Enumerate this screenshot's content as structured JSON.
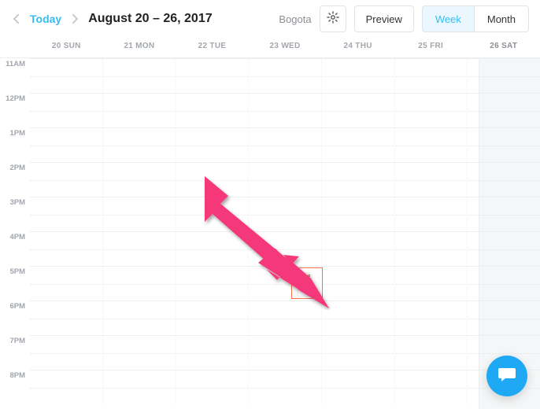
{
  "toolbar": {
    "today_label": "Today",
    "date_range": "August 20 – 26, 2017",
    "timezone": "Bogota",
    "preview_label": "Preview",
    "view_week_label": "Week",
    "view_month_label": "Month"
  },
  "days": [
    {
      "num": "20",
      "dow": "SUN"
    },
    {
      "num": "21",
      "dow": "MON"
    },
    {
      "num": "22",
      "dow": "TUE"
    },
    {
      "num": "23",
      "dow": "WED"
    },
    {
      "num": "24",
      "dow": "THU"
    },
    {
      "num": "25",
      "dow": "FRI"
    },
    {
      "num": "26",
      "dow": "SAT"
    }
  ],
  "hours": [
    "11AM",
    "12PM",
    "1PM",
    "2PM",
    "3PM",
    "4PM",
    "5PM",
    "6PM",
    "7PM",
    "8PM"
  ],
  "event": {
    "day": "24 THU",
    "start": "5PM"
  }
}
